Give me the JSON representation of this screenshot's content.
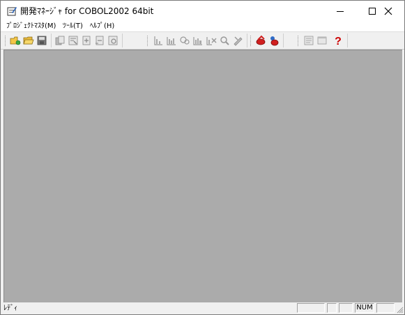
{
  "window": {
    "title": "開発ﾏﾈｰｼﾞｬ for COBOL2002 64bit",
    "controls": [
      "minimize",
      "maximize",
      "close"
    ]
  },
  "menu": {
    "items": [
      {
        "label": "ﾌﾟﾛｼﾞｪｸﾄﾏｽﾀ(M)"
      },
      {
        "label": "ﾂｰﾙ(T)"
      },
      {
        "label": "ﾍﾙﾌﾟ(H)"
      }
    ]
  },
  "toolbar": {
    "groups": [
      [
        "new-project-icon",
        "open-folder-icon",
        "save-icon"
      ],
      [
        "copy-icon",
        "properties-icon",
        "add-file-icon",
        "remove-file-icon",
        "settings-icon"
      ],
      [
        "build-icon",
        "build-all-icon",
        "compile-icon",
        "link-icon",
        "clean-icon",
        "find-icon",
        "tools-icon"
      ],
      [
        "debug-icon",
        "test-icon"
      ],
      [
        "document-icon",
        "window-icon",
        "help-icon"
      ]
    ]
  },
  "status": {
    "text": "ﾚﾃﾞｨ",
    "num_indicator": "NUM"
  },
  "colors": {
    "client_bg": "#ababab",
    "chrome_bg": "#f0f0f0",
    "help_red": "#cc0000"
  }
}
